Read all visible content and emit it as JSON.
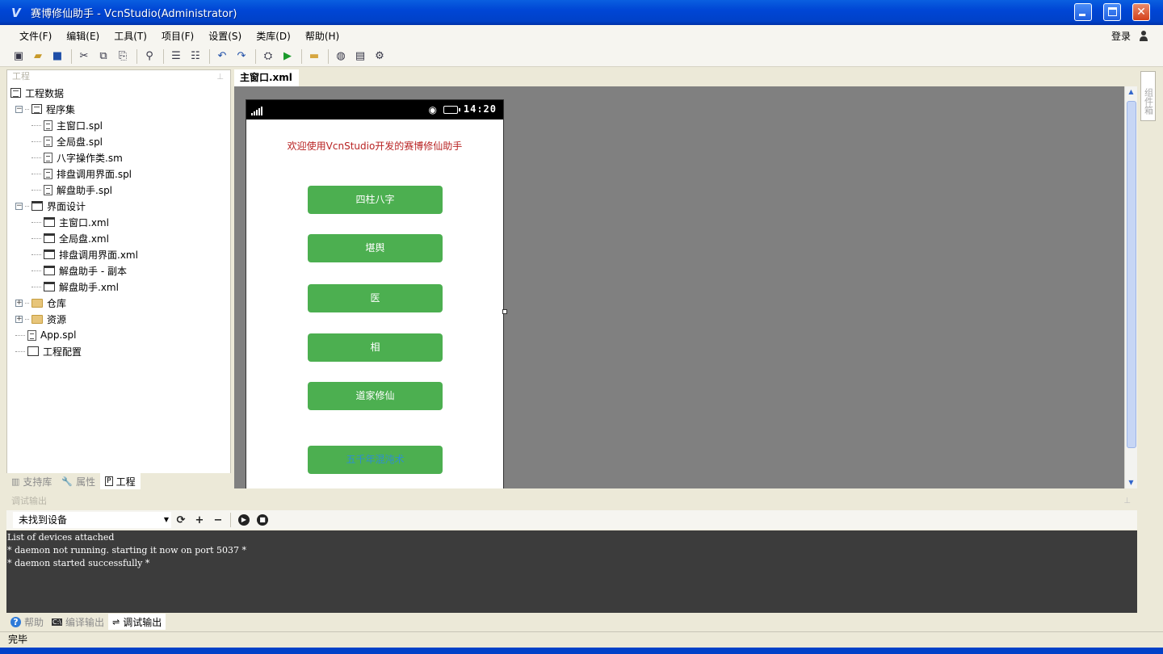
{
  "window": {
    "title": "赛博修仙助手 - VcnStudio(Administrator)",
    "logo": "V"
  },
  "menu": {
    "items": [
      "文件(F)",
      "编辑(E)",
      "工具(T)",
      "项目(F)",
      "设置(S)",
      "类库(D)",
      "帮助(H)"
    ],
    "login": "登录"
  },
  "project_panel": {
    "caption": "工程",
    "tree": [
      {
        "label": "工程数据",
        "level": 0,
        "icon": "project-icon"
      },
      {
        "label": "程序集",
        "level": 1,
        "icon": "assembly-icon",
        "expander": "−"
      },
      {
        "label": "主窗口.spl",
        "level": 2,
        "icon": "document-icon"
      },
      {
        "label": "全局盘.spl",
        "level": 2,
        "icon": "document-icon"
      },
      {
        "label": "八字操作类.sm",
        "level": 2,
        "icon": "document-icon"
      },
      {
        "label": "排盘调用界面.spl",
        "level": 2,
        "icon": "document-icon"
      },
      {
        "label": "解盘助手.spl",
        "level": 2,
        "icon": "document-icon"
      },
      {
        "label": "界面设计",
        "level": 1,
        "icon": "window-icon",
        "expander": "−"
      },
      {
        "label": "主窗口.xml",
        "level": 2,
        "icon": "window-icon"
      },
      {
        "label": "全局盘.xml",
        "level": 2,
        "icon": "window-icon"
      },
      {
        "label": "排盘调用界面.xml",
        "level": 2,
        "icon": "window-icon"
      },
      {
        "label": "解盘助手 - 副本",
        "level": 2,
        "icon": "window-icon"
      },
      {
        "label": "解盘助手.xml",
        "level": 2,
        "icon": "window-icon"
      },
      {
        "label": "仓库",
        "level": 1,
        "icon": "folder-icon",
        "expander": "+"
      },
      {
        "label": "资源",
        "level": 1,
        "icon": "folder-icon",
        "expander": "+"
      },
      {
        "label": "App.spl",
        "level": 1,
        "icon": "document-icon"
      },
      {
        "label": "工程配置",
        "level": 1,
        "icon": "config-icon"
      }
    ],
    "tabs": [
      {
        "label": "支持库",
        "icon": "library-icon",
        "active": false
      },
      {
        "label": "属性",
        "icon": "wrench-icon",
        "active": false
      },
      {
        "label": "工程",
        "icon": "project-tab-icon",
        "active": true
      }
    ]
  },
  "editor": {
    "tab": "主窗口.xml",
    "toolbox_label": "组件箱"
  },
  "phone": {
    "clock": "14:20",
    "welcome": "欢迎使用VcnStudio开发的赛博修仙助手",
    "buttons": [
      "四柱八字",
      "堪舆",
      "医",
      "相",
      "道家修仙",
      "五千年混沌术"
    ]
  },
  "output_panel": {
    "caption": "调试输出",
    "device_select": "未找到设备",
    "console_lines": [
      "List of devices attached",
      "* daemon not running. starting it now on port 5037 *",
      "* daemon started successfully *"
    ],
    "tabs": [
      {
        "label": "帮助",
        "active": false
      },
      {
        "label": "编译输出",
        "active": false
      },
      {
        "label": "调试输出",
        "active": true
      }
    ]
  },
  "status": {
    "text": "完毕"
  }
}
